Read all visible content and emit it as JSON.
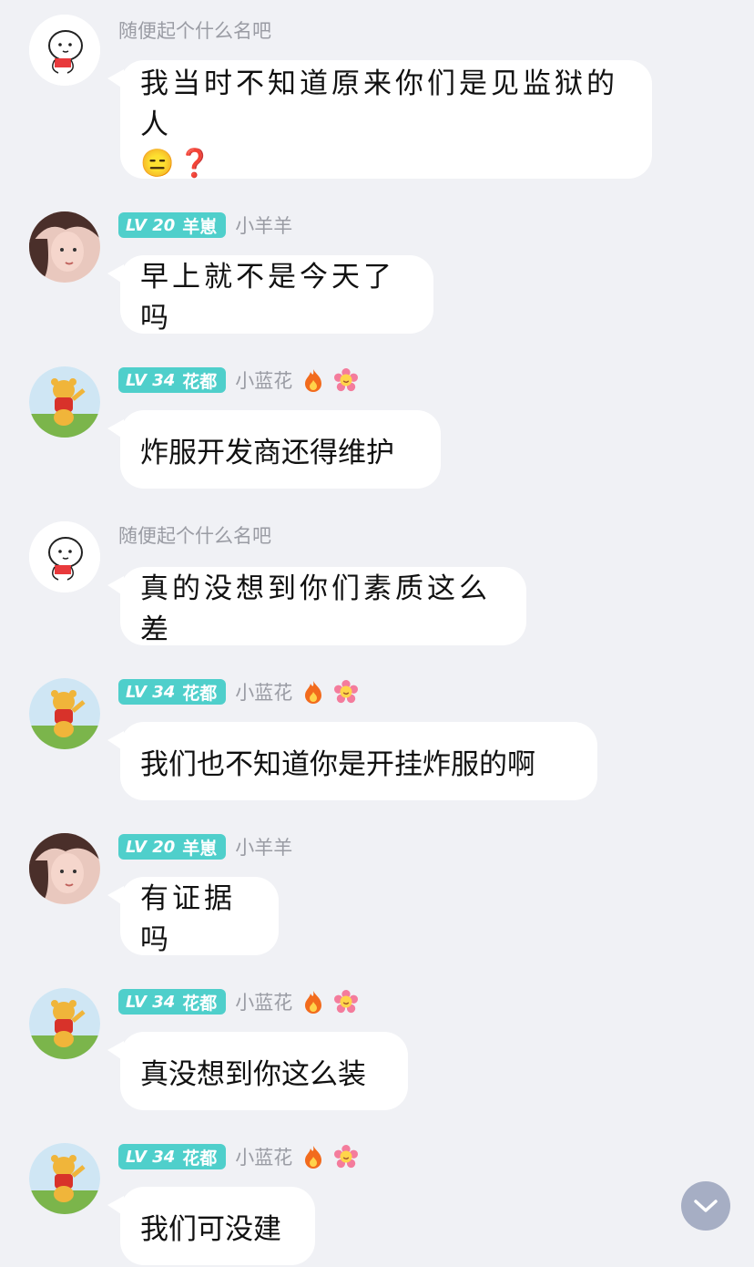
{
  "messages": [
    {
      "sender": "随便起个什么名吧",
      "text": "我当时不知道原来你们是见监狱的人",
      "emoji": "😑❓",
      "avatar_icon": "sketch-man-avatar"
    },
    {
      "sender": "小羊羊",
      "level": "LV 20",
      "group": "羊崽",
      "text": "早上就不是今天了吗",
      "avatar_icon": "girl-photo-avatar"
    },
    {
      "sender": "小蓝花",
      "level": "LV 34",
      "group": "花都",
      "text": "炸服开发商还得维护",
      "avatar_icon": "pooh-bear-avatar"
    },
    {
      "sender": "随便起个什么名吧",
      "text": "真的没想到你们素质这么差",
      "avatar_icon": "sketch-man-avatar"
    },
    {
      "sender": "小蓝花",
      "level": "LV 34",
      "group": "花都",
      "text": "我们也不知道你是开挂炸服的啊",
      "avatar_icon": "pooh-bear-avatar"
    },
    {
      "sender": "小羊羊",
      "level": "LV 20",
      "group": "羊崽",
      "text": "有证据吗",
      "avatar_icon": "girl-photo-avatar"
    },
    {
      "sender": "小蓝花",
      "level": "LV 34",
      "group": "花都",
      "text": "真没想到你这么装",
      "avatar_icon": "pooh-bear-avatar"
    },
    {
      "sender": "小蓝花",
      "level": "LV 34",
      "group": "花都",
      "text": "我们可没建",
      "avatar_icon": "pooh-bear-avatar"
    }
  ],
  "colors": {
    "badge": "#4fcfcb",
    "background": "#f0f1f5",
    "bubble": "#ffffff",
    "nickname": "#9a9ca4",
    "scroll_button": "#a6aec4"
  },
  "scroll_button_icon": "chevron-down-icon"
}
